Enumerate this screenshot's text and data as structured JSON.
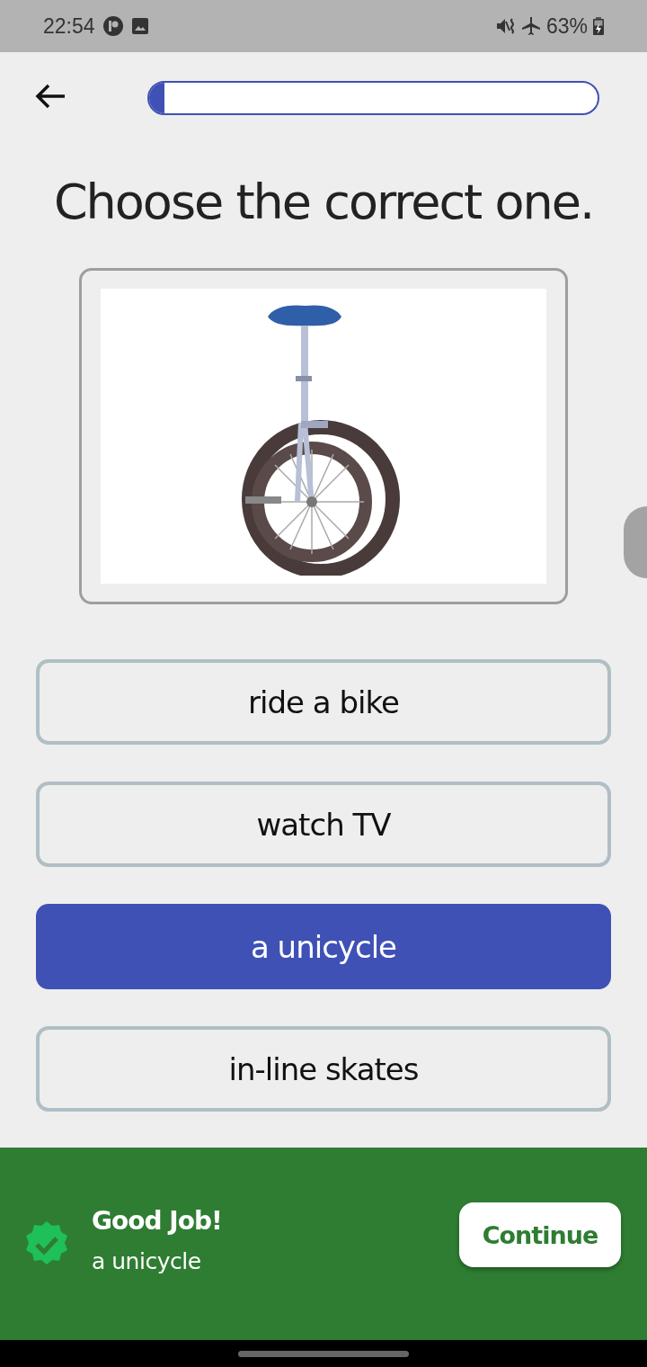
{
  "status_bar": {
    "time": "22:54",
    "battery_percent": "63%"
  },
  "progress": {
    "level": 0.035
  },
  "title": "Choose the correct one.",
  "options": [
    {
      "label": "ride a bike",
      "selected": false
    },
    {
      "label": "watch TV",
      "selected": false
    },
    {
      "label": "a unicycle",
      "selected": true
    },
    {
      "label": "in-line skates",
      "selected": false
    }
  ],
  "feedback": {
    "title": "Good Job!",
    "answer": "a unicycle",
    "button": "Continue"
  }
}
